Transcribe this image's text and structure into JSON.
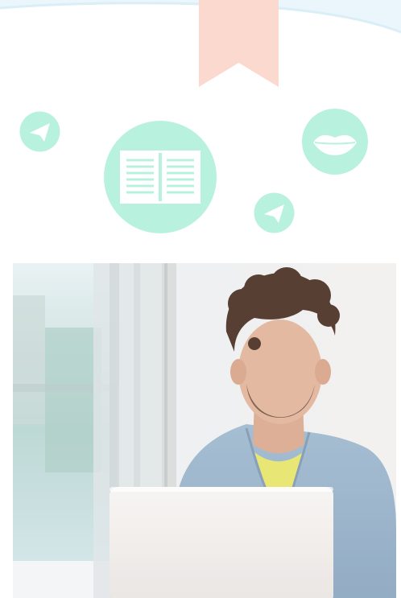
{
  "colors": {
    "mint": "#b8f2df",
    "mint_border": "#a9eed7",
    "bookmark_pink": "#fbd9cf",
    "arc_blue": "#d9eef7",
    "white": "#ffffff"
  },
  "icons": {
    "top_ribbon": "bookmark-icon",
    "plane_1": "paper-plane-icon",
    "book": "open-book-icon",
    "plane_2": "paper-plane-icon",
    "lips": "lips-icon"
  },
  "photo": {
    "subject": "man-with-laptop-photo"
  }
}
